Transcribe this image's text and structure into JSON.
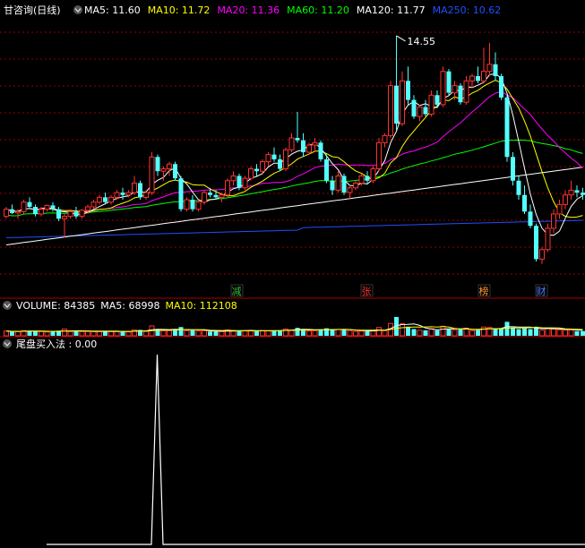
{
  "main_panel": {
    "security": "甘咨询(日线)",
    "ma_labels": [
      {
        "text": "MA5: 11.60",
        "color": "#ffffff"
      },
      {
        "text": "MA10: 11.72",
        "color": "#ffff00"
      },
      {
        "text": "MA20: 11.36",
        "color": "#ff00ff"
      },
      {
        "text": "MA60: 11.20",
        "color": "#00ff00"
      },
      {
        "text": "MA120: 11.77",
        "color": "#ffffff"
      },
      {
        "text": "MA250: 10.62",
        "color": "#1e50ff"
      }
    ],
    "high_marker": "14.55",
    "event_tags": [
      {
        "label": "减",
        "color": "#33bb33"
      },
      {
        "label": "张",
        "color": "#ff3333"
      },
      {
        "label": "榜",
        "color": "#ff9933"
      },
      {
        "label": "财",
        "color": "#4d7dff"
      }
    ]
  },
  "volume_panel": {
    "ma_labels": [
      {
        "text": "VOLUME: 84385",
        "color": "#ffffff"
      },
      {
        "text": "MA5: 68998",
        "color": "#ffffff"
      },
      {
        "text": "MA10: 112108",
        "color": "#ffff00"
      }
    ]
  },
  "indicator_panel": {
    "label": "尾盘买入法 : 0.00",
    "label_color": "#ffffff"
  },
  "colors": {
    "up": "#ff3232",
    "down": "#54ffff",
    "ma5": "#ffffff",
    "ma10": "#ffff00",
    "ma20": "#ff00ff",
    "ma60": "#00ff00",
    "ma120": "#ffffff",
    "ma250": "#1e50ff",
    "grid": "#990000",
    "separator": "#aa0000",
    "toggle_icon": "#888888"
  },
  "chart_data": {
    "type": "candlestick",
    "candles": [
      [
        10.75,
        10.95,
        10.7,
        10.9
      ],
      [
        10.9,
        11.0,
        10.8,
        10.82
      ],
      [
        10.82,
        10.9,
        10.7,
        10.85
      ],
      [
        10.85,
        11.1,
        10.8,
        11.05
      ],
      [
        11.05,
        11.15,
        10.9,
        10.95
      ],
      [
        10.95,
        11.0,
        10.75,
        10.8
      ],
      [
        10.8,
        10.95,
        10.75,
        10.9
      ],
      [
        10.9,
        11.0,
        10.85,
        10.98
      ],
      [
        10.98,
        11.05,
        10.85,
        10.9
      ],
      [
        10.9,
        10.95,
        10.65,
        10.7
      ],
      [
        10.7,
        10.8,
        10.3,
        10.75
      ],
      [
        10.75,
        10.9,
        10.7,
        10.85
      ],
      [
        10.85,
        10.95,
        10.7,
        10.75
      ],
      [
        10.75,
        10.9,
        10.7,
        10.88
      ],
      [
        10.88,
        11.0,
        10.8,
        10.95
      ],
      [
        10.95,
        11.1,
        10.9,
        11.05
      ],
      [
        11.05,
        11.2,
        11.0,
        11.15
      ],
      [
        11.15,
        11.25,
        11.0,
        11.05
      ],
      [
        11.05,
        11.2,
        11.0,
        11.15
      ],
      [
        11.15,
        11.3,
        11.1,
        11.25
      ],
      [
        11.25,
        11.35,
        11.1,
        11.2
      ],
      [
        11.2,
        11.3,
        11.15,
        11.25
      ],
      [
        11.25,
        11.6,
        11.2,
        11.45
      ],
      [
        11.45,
        11.5,
        11.1,
        11.15
      ],
      [
        11.15,
        11.3,
        11.1,
        11.25
      ],
      [
        11.25,
        12.1,
        11.2,
        12.0
      ],
      [
        12.0,
        12.05,
        11.6,
        11.7
      ],
      [
        11.7,
        11.8,
        11.5,
        11.75
      ],
      [
        11.75,
        11.9,
        11.6,
        11.85
      ],
      [
        11.85,
        11.9,
        11.5,
        11.55
      ],
      [
        11.55,
        11.6,
        10.85,
        10.9
      ],
      [
        10.9,
        11.15,
        10.85,
        11.1
      ],
      [
        11.1,
        11.2,
        10.85,
        10.9
      ],
      [
        10.9,
        11.1,
        10.85,
        11.05
      ],
      [
        11.05,
        11.3,
        11.0,
        11.25
      ],
      [
        11.25,
        11.35,
        11.15,
        11.2
      ],
      [
        11.2,
        11.3,
        11.1,
        11.15
      ],
      [
        11.15,
        11.25,
        11.05,
        11.2
      ],
      [
        11.2,
        11.55,
        11.15,
        11.5
      ],
      [
        11.5,
        11.7,
        11.4,
        11.6
      ],
      [
        11.6,
        11.65,
        11.3,
        11.35
      ],
      [
        11.35,
        11.6,
        11.3,
        11.55
      ],
      [
        11.55,
        11.8,
        11.5,
        11.75
      ],
      [
        11.75,
        11.85,
        11.6,
        11.7
      ],
      [
        11.7,
        11.95,
        11.65,
        11.9
      ],
      [
        11.9,
        12.1,
        11.8,
        12.05
      ],
      [
        12.05,
        12.2,
        11.9,
        11.95
      ],
      [
        11.95,
        12.05,
        11.7,
        11.75
      ],
      [
        11.75,
        12.2,
        11.7,
        12.15
      ],
      [
        12.15,
        12.5,
        12.1,
        12.4
      ],
      [
        12.4,
        12.95,
        12.3,
        12.35
      ],
      [
        12.35,
        12.5,
        12.0,
        12.1
      ],
      [
        12.1,
        12.3,
        12.05,
        12.25
      ],
      [
        12.25,
        12.4,
        12.1,
        12.3
      ],
      [
        12.3,
        12.35,
        11.9,
        11.95
      ],
      [
        11.95,
        12.05,
        11.45,
        11.5
      ],
      [
        11.5,
        11.6,
        11.2,
        11.3
      ],
      [
        11.3,
        11.7,
        11.25,
        11.6
      ],
      [
        11.6,
        11.65,
        11.2,
        11.25
      ],
      [
        11.25,
        11.4,
        11.1,
        11.35
      ],
      [
        11.35,
        11.5,
        11.3,
        11.45
      ],
      [
        11.45,
        11.65,
        11.4,
        11.6
      ],
      [
        11.6,
        11.7,
        11.45,
        11.5
      ],
      [
        11.5,
        11.8,
        11.45,
        11.75
      ],
      [
        11.75,
        12.4,
        11.7,
        12.3
      ],
      [
        12.3,
        12.5,
        12.2,
        12.45
      ],
      [
        12.45,
        13.6,
        12.4,
        13.5
      ],
      [
        13.5,
        14.55,
        12.55,
        12.7
      ],
      [
        12.7,
        13.8,
        12.65,
        13.6
      ],
      [
        13.6,
        13.9,
        13.1,
        13.2
      ],
      [
        13.2,
        13.3,
        12.8,
        12.85
      ],
      [
        12.85,
        13.1,
        12.75,
        13.05
      ],
      [
        13.05,
        13.2,
        12.85,
        12.9
      ],
      [
        12.9,
        13.4,
        12.85,
        13.3
      ],
      [
        13.3,
        13.4,
        13.05,
        13.1
      ],
      [
        13.1,
        13.9,
        13.05,
        13.8
      ],
      [
        13.8,
        13.85,
        13.3,
        13.35
      ],
      [
        13.35,
        13.6,
        13.2,
        13.5
      ],
      [
        13.5,
        13.55,
        13.1,
        13.15
      ],
      [
        13.15,
        13.7,
        13.1,
        13.6
      ],
      [
        13.6,
        13.75,
        13.45,
        13.7
      ],
      [
        13.7,
        13.9,
        13.55,
        13.6
      ],
      [
        13.6,
        14.3,
        13.55,
        13.8
      ],
      [
        13.8,
        14.4,
        13.7,
        13.95
      ],
      [
        13.95,
        14.2,
        13.6,
        13.7
      ],
      [
        13.7,
        13.75,
        13.2,
        13.25
      ],
      [
        13.25,
        13.3,
        11.9,
        12.0
      ],
      [
        12.0,
        12.1,
        11.4,
        11.5
      ],
      [
        11.5,
        11.6,
        11.1,
        11.2
      ],
      [
        11.2,
        11.4,
        10.8,
        10.85
      ],
      [
        10.85,
        11.0,
        10.5,
        10.55
      ],
      [
        10.55,
        10.6,
        9.8,
        9.85
      ],
      [
        9.85,
        10.1,
        9.75,
        10.05
      ],
      [
        10.05,
        10.6,
        10.0,
        10.5
      ],
      [
        10.5,
        10.9,
        10.4,
        10.8
      ],
      [
        10.8,
        11.1,
        10.7,
        11.0
      ],
      [
        11.0,
        11.3,
        10.9,
        11.2
      ],
      [
        11.2,
        11.5,
        11.1,
        11.3
      ],
      [
        11.3,
        11.4,
        11.15,
        11.25
      ],
      [
        11.25,
        11.35,
        11.1,
        11.2
      ]
    ],
    "price_range": [
      9.65,
      14.85
    ],
    "indicator": {
      "name": "尾盘买入法",
      "signals": [
        0,
        0,
        0,
        0,
        0,
        0,
        0,
        0,
        0,
        0,
        0,
        0,
        0,
        0,
        0,
        0,
        0,
        0,
        0,
        1,
        0,
        0,
        0,
        0,
        0,
        0,
        0,
        0,
        0,
        0,
        0,
        0,
        0,
        0,
        0,
        0,
        0,
        0,
        0,
        0,
        0,
        0,
        0,
        0,
        0,
        0,
        0,
        0,
        0,
        0,
        0,
        0,
        0,
        0,
        0,
        0,
        0,
        0,
        0,
        0,
        0,
        0,
        0,
        0,
        0,
        0,
        0,
        0,
        0,
        0,
        0,
        0,
        0,
        0,
        0,
        0,
        0,
        0,
        0,
        0,
        0,
        0,
        0,
        0,
        0,
        0,
        0,
        0,
        0,
        0,
        0,
        0,
        0,
        0,
        0,
        0,
        0,
        0,
        0,
        0
      ]
    }
  }
}
